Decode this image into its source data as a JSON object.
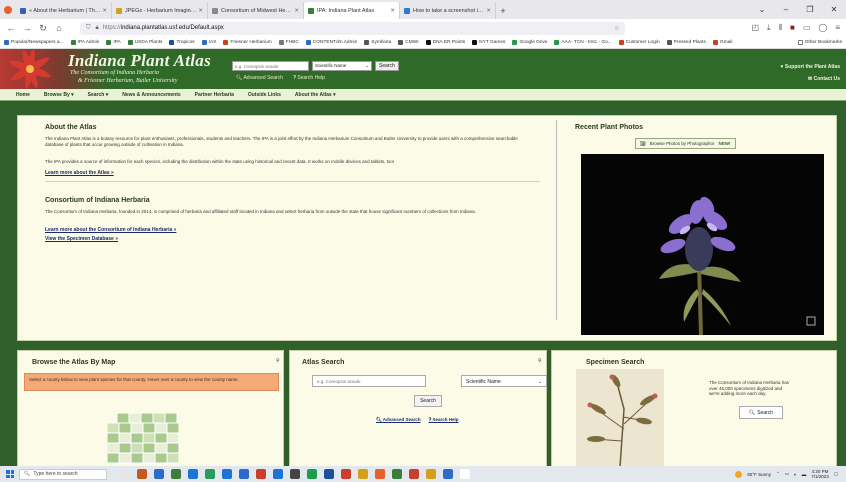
{
  "browser": {
    "tabs": [
      {
        "label": "« About the Herbarium | The H",
        "color": "#3a5fb0",
        "active": false
      },
      {
        "label": "JPEGs - Herbarium Imaging - G",
        "color": "#d4a017",
        "active": false
      },
      {
        "label": "Consortium of Midwest Herbaria",
        "color": "#8a8a8a",
        "active": false
      },
      {
        "label": "IPA: Indiana Plant Atlas",
        "color": "#3b7d3a",
        "active": true
      },
      {
        "label": "How to take a screenshot in Wi",
        "color": "#2a7ad2",
        "active": false
      }
    ],
    "url_prefix": "https://",
    "url": "indiana.plantatlas.usf.edu/Default.aspx",
    "bookmarks": [
      {
        "label": "Popular/Newspapers a...",
        "color": "#2a6cc7"
      },
      {
        "label": "IPA Admin",
        "color": "#3b7d3a"
      },
      {
        "label": "IPA",
        "color": "#3b7d3a"
      },
      {
        "label": "USDA Plants",
        "color": "#3b7d3a"
      },
      {
        "label": "Tropicos",
        "color": "#1a4f9c"
      },
      {
        "label": "IAS",
        "color": "#2a6cc7"
      },
      {
        "label": "Friesner Herbarium",
        "color": "#c8402a"
      },
      {
        "label": "FHBC",
        "color": "#777777"
      },
      {
        "label": "CONTENTdm Admin",
        "color": "#2a6cc7"
      },
      {
        "label": "Symbiota",
        "color": "#555555"
      },
      {
        "label": "CMWI",
        "color": "#555555"
      },
      {
        "label": "DNA ER Points",
        "color": "#111111"
      },
      {
        "label": "NYT Games",
        "color": "#111111"
      },
      {
        "label": "Google Drive",
        "color": "#1e9e4a"
      },
      {
        "label": "AAA- TCN - tmtc - Go...",
        "color": "#1e9e4a"
      },
      {
        "label": "Customer Login",
        "color": "#c8402a"
      },
      {
        "label": "Pressed Plants",
        "color": "#555555"
      },
      {
        "label": "Gmail",
        "color": "#c8402a"
      }
    ],
    "other_bookmarks": "Other Bookmarks"
  },
  "site": {
    "title": "Indiana Plant Atlas",
    "subtitle1": "The Consortium of Indiana Herbaria",
    "subtitle2": "& Friesner Herbarium, Butler University",
    "search_placeholder": "e.g. Coreopsis acaule",
    "search_mode": "Scientific Name",
    "search_button": "Search",
    "advanced_search": "Advanced Search",
    "search_help": "Search Help",
    "support_link": "Support the Plant Atlas",
    "contact_link": "Contact Us",
    "menu": [
      "Home",
      "Browse By ▾",
      "Search ▾",
      "News & Announcements",
      "Partner Herbaria",
      "Outside Links",
      "About the Atlas ▾"
    ]
  },
  "about": {
    "heading": "About the Atlas",
    "para1": "The Indiana Plant Atlas is a botany resource for plant enthusiasts, professionals, students and teachers. The IPA is a joint effort by the Indiana Herbarium Consortium and Butler University to provide users with a comprehensive searchable database of plants that occur growing outside of cultivation in Indiana.",
    "para2": "The IPA provides a source of information for each species, including the distribution within the state using historical and recent data. It works on mobile devices and tablets, too!",
    "learn_more": "Learn more about the Atlas »",
    "consortium_heading": "Consortium of Indiana Herbaria",
    "consortium_para": "The Consortium of Indiana Herbaria, founded in 2014, is comprised of herbaria and affiliated staff located in Indiana and select herbaria from outside the state that house significant numbers of collections from Indiana.",
    "consortium_link": "Learn more about the Consortium of Indiana Herbaria »",
    "specimen_link": "View the Specimen Database »"
  },
  "recent": {
    "heading": "Recent Plant Photos",
    "browse_button": "Browse Photos by Photographor",
    "new_badge": "NEW!"
  },
  "browse_map": {
    "heading": "Browse the Atlas By Map",
    "notice": "Select a county below to view plant species for that county. Hover over a county to view the county name."
  },
  "atlas_search": {
    "heading": "Atlas Search",
    "placeholder": "e.g. Coreopsis acaule",
    "mode": "Scientific Name",
    "button": "Search",
    "advanced": "Advanced Search",
    "help": "Search Help"
  },
  "specimen": {
    "heading": "Specimen Search",
    "text": "The Consortium of Indiana Herbaria has over 45,000 specimens digitized and we're adding more each day.",
    "button": "Search"
  },
  "taskbar": {
    "search_placeholder": "Type here to search",
    "weather": "65°F Sunny",
    "time": "4:20 PM",
    "date": "7/1/2023",
    "apps": [
      "#e6e6e6",
      "#c45a1d",
      "#2a6cc7",
      "#3b7d3a",
      "#1e73d6",
      "#2a9a5e",
      "#1e73d6",
      "#2a6cc7",
      "#c8402a",
      "#1e73d6",
      "#444444",
      "#1e9e4a",
      "#1a4f9c",
      "#c8402a",
      "#d4a017",
      "#e8612c",
      "#3b7d3a",
      "#c8402a",
      "#d4a017",
      "#2a6cc7",
      "#ffffff"
    ]
  }
}
